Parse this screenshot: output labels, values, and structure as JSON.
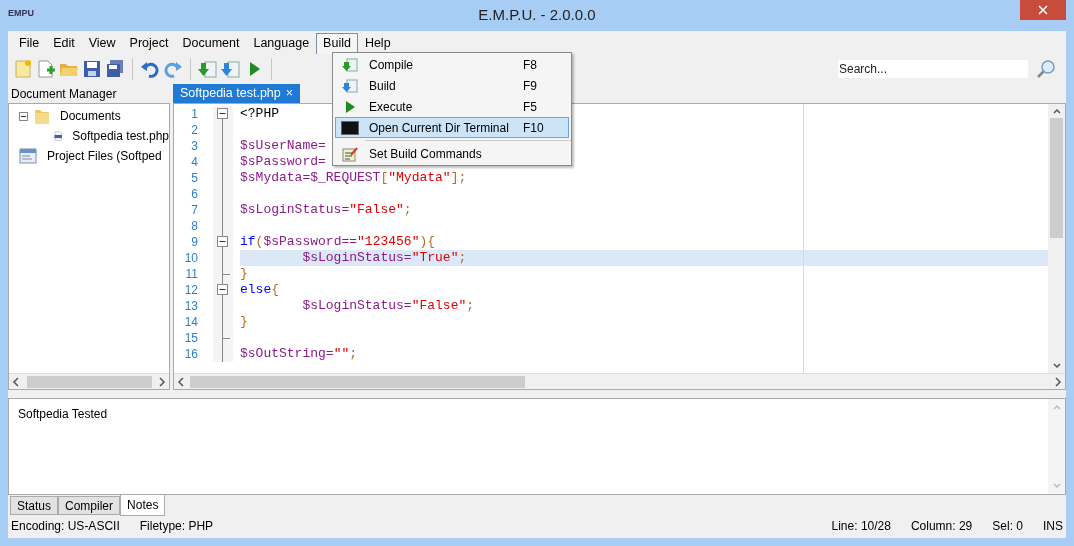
{
  "window": {
    "logo": "EMPU",
    "title": "E.M.P.U. - 2.0.0.0"
  },
  "menu_bar": [
    {
      "label": "File",
      "selected": false
    },
    {
      "label": "Edit",
      "selected": false
    },
    {
      "label": "View",
      "selected": false
    },
    {
      "label": "Project",
      "selected": false
    },
    {
      "label": "Document",
      "selected": false
    },
    {
      "label": "Language",
      "selected": false
    },
    {
      "label": "Build",
      "selected": true
    },
    {
      "label": "Help",
      "selected": false
    }
  ],
  "search": {
    "placeholder": "Search..."
  },
  "document_manager": {
    "title": "Document Manager",
    "tree": [
      {
        "label": "Documents",
        "kind": "folder",
        "expanded": true,
        "children": [
          {
            "label": "Softpedia test.php",
            "kind": "php"
          }
        ]
      },
      {
        "label": "Project Files (Softped",
        "kind": "project"
      }
    ]
  },
  "editor": {
    "tabs": [
      {
        "label": "Softpedia test.php",
        "close": "×",
        "selected": true
      }
    ],
    "lines": [
      {
        "number": "1",
        "fold_start": true,
        "fold_end": false,
        "highlighted": false,
        "tokens": [
          {
            "kind": "plain",
            "text": "<?PHP"
          }
        ]
      },
      {
        "number": "2",
        "fold_start": false,
        "fold_end": false,
        "highlighted": false
      },
      {
        "number": "3",
        "fold_start": false,
        "fold_end": false,
        "highlighted": false,
        "tokens": [
          {
            "kind": "var",
            "text": "$sUserName="
          }
        ]
      },
      {
        "number": "4",
        "fold_start": false,
        "fold_end": false,
        "highlighted": false,
        "tokens": [
          {
            "kind": "var",
            "text": "$sPassword="
          }
        ]
      },
      {
        "number": "5",
        "fold_start": false,
        "fold_end": false,
        "highlighted": false,
        "tokens": [
          {
            "kind": "var",
            "text": "$sMydata=$_REQUEST"
          },
          {
            "kind": "op",
            "text": "["
          },
          {
            "kind": "str",
            "text": "\"Mydata\""
          },
          {
            "kind": "op",
            "text": "];"
          }
        ]
      },
      {
        "number": "6",
        "fold_start": false,
        "fold_end": false,
        "highlighted": false
      },
      {
        "number": "7",
        "fold_start": false,
        "fold_end": false,
        "highlighted": false,
        "tokens": [
          {
            "kind": "var",
            "text": "$sLoginStatus="
          },
          {
            "kind": "str",
            "text": "\"False\""
          },
          {
            "kind": "op",
            "text": ";"
          }
        ]
      },
      {
        "number": "8",
        "fold_start": false,
        "fold_end": false,
        "highlighted": false
      },
      {
        "number": "9",
        "fold_start": true,
        "fold_end": false,
        "highlighted": false,
        "tokens": [
          {
            "kind": "kw",
            "text": "if"
          },
          {
            "kind": "op",
            "text": "("
          },
          {
            "kind": "var",
            "text": "$sPassword=="
          },
          {
            "kind": "str",
            "text": "\"123456\""
          },
          {
            "kind": "op",
            "text": "){"
          }
        ]
      },
      {
        "number": "10",
        "fold_start": false,
        "fold_end": false,
        "highlighted": true,
        "tokens": [
          {
            "kind": "var",
            "text": "        $sLoginStatus="
          },
          {
            "kind": "str",
            "text": "\"True\""
          },
          {
            "kind": "op",
            "text": ";"
          }
        ]
      },
      {
        "number": "11",
        "fold_start": false,
        "fold_end": true,
        "highlighted": false,
        "tokens": [
          {
            "kind": "op",
            "text": "}"
          }
        ]
      },
      {
        "number": "12",
        "fold_start": true,
        "fold_end": false,
        "highlighted": false,
        "tokens": [
          {
            "kind": "kw",
            "text": "else"
          },
          {
            "kind": "op",
            "text": "{"
          }
        ]
      },
      {
        "number": "13",
        "fold_start": false,
        "fold_end": false,
        "highlighted": false,
        "tokens": [
          {
            "kind": "var",
            "text": "        $sLoginStatus="
          },
          {
            "kind": "str",
            "text": "\"False\""
          },
          {
            "kind": "op",
            "text": ";"
          }
        ]
      },
      {
        "number": "14",
        "fold_start": false,
        "fold_end": false,
        "highlighted": false,
        "tokens": [
          {
            "kind": "op",
            "text": "}"
          }
        ]
      },
      {
        "number": "15",
        "fold_start": false,
        "fold_end": true,
        "highlighted": false
      },
      {
        "number": "16",
        "fold_start": false,
        "fold_end": false,
        "highlighted": false,
        "tokens": [
          {
            "kind": "var",
            "text": "$sOutString="
          },
          {
            "kind": "str",
            "text": "\"\""
          },
          {
            "kind": "op",
            "text": ";"
          }
        ]
      }
    ]
  },
  "build_menu": [
    {
      "kind": "compile",
      "label": "Compile",
      "shortcut": "F8",
      "highlighted": false
    },
    {
      "kind": "build",
      "label": "Build",
      "shortcut": "F9",
      "highlighted": false
    },
    {
      "kind": "execute",
      "label": "Execute",
      "shortcut": "F5",
      "highlighted": false
    },
    {
      "kind": "terminal",
      "label": "Open Current Dir Terminal",
      "shortcut": "F10",
      "highlighted": true
    },
    {
      "kind": "separator"
    },
    {
      "kind": "settings",
      "label": "Set Build Commands",
      "highlighted": false
    }
  ],
  "notes": {
    "text": "Softpedia Tested"
  },
  "bottom_tabs": [
    {
      "label": "Status",
      "selected": false
    },
    {
      "label": "Compiler",
      "selected": false
    },
    {
      "label": "Notes",
      "selected": true
    }
  ],
  "status_bar": {
    "left": [
      "Encoding: US-ASCII",
      "Filetype: PHP"
    ],
    "right": [
      "Line: 10/28",
      "Column: 29",
      "Sel: 0",
      "INS"
    ]
  }
}
